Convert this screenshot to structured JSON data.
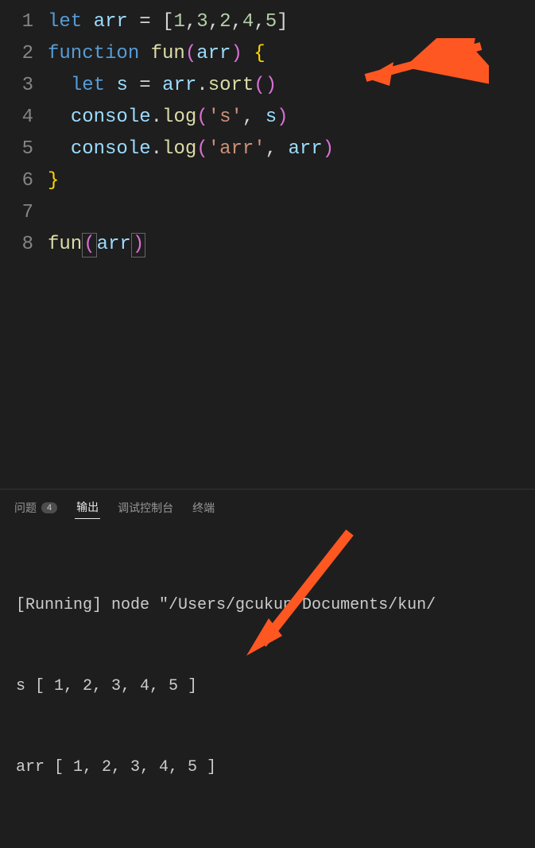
{
  "editor": {
    "line_numbers": [
      "1",
      "2",
      "3",
      "4",
      "5",
      "6",
      "7",
      "8"
    ],
    "lines": {
      "l1_let": "let",
      "l1_var": "arr",
      "l1_eq": " = ",
      "l1_open": "[",
      "l1_n1": "1",
      "l1_c1": ",",
      "l1_n2": "3",
      "l1_c2": ",",
      "l1_n3": "2",
      "l1_c3": ",",
      "l1_n4": "4",
      "l1_c4": ",",
      "l1_n5": "5",
      "l1_close": "]",
      "l2_func": "function",
      "l2_name": "fun",
      "l2_po": "(",
      "l2_arg": "arr",
      "l2_pc": ")",
      "l2_bo": "{",
      "l3_let": "let",
      "l3_var": "s",
      "l3_eq": " = ",
      "l3_obj": "arr",
      "l3_dot": ".",
      "l3_method": "sort",
      "l3_po": "(",
      "l3_pc": ")",
      "l4_obj": "console",
      "l4_dot": ".",
      "l4_method": "log",
      "l4_po": "(",
      "l4_str": "'s'",
      "l4_comma": ", ",
      "l4_arg": "s",
      "l4_pc": ")",
      "l5_obj": "console",
      "l5_dot": ".",
      "l5_method": "log",
      "l5_po": "(",
      "l5_str": "'arr'",
      "l5_comma": ", ",
      "l5_arg": "arr",
      "l5_pc": ")",
      "l6_bc": "}",
      "l8_call": "fun",
      "l8_po": "(",
      "l8_arg": "arr",
      "l8_pc": ")"
    }
  },
  "panel": {
    "tabs": {
      "problems": "问题",
      "problems_badge": "4",
      "output": "输出",
      "debug": "调试控制台",
      "terminal": "终端"
    },
    "output_lines": {
      "running": "[Running] node \"/Users/gcukun/Documents/kun/",
      "s_result": "s [ 1, 2, 3, 4, 5 ]",
      "arr_result": "arr [ 1, 2, 3, 4, 5 ]"
    }
  },
  "annotations": {
    "arrow_color": "#ff5722"
  }
}
